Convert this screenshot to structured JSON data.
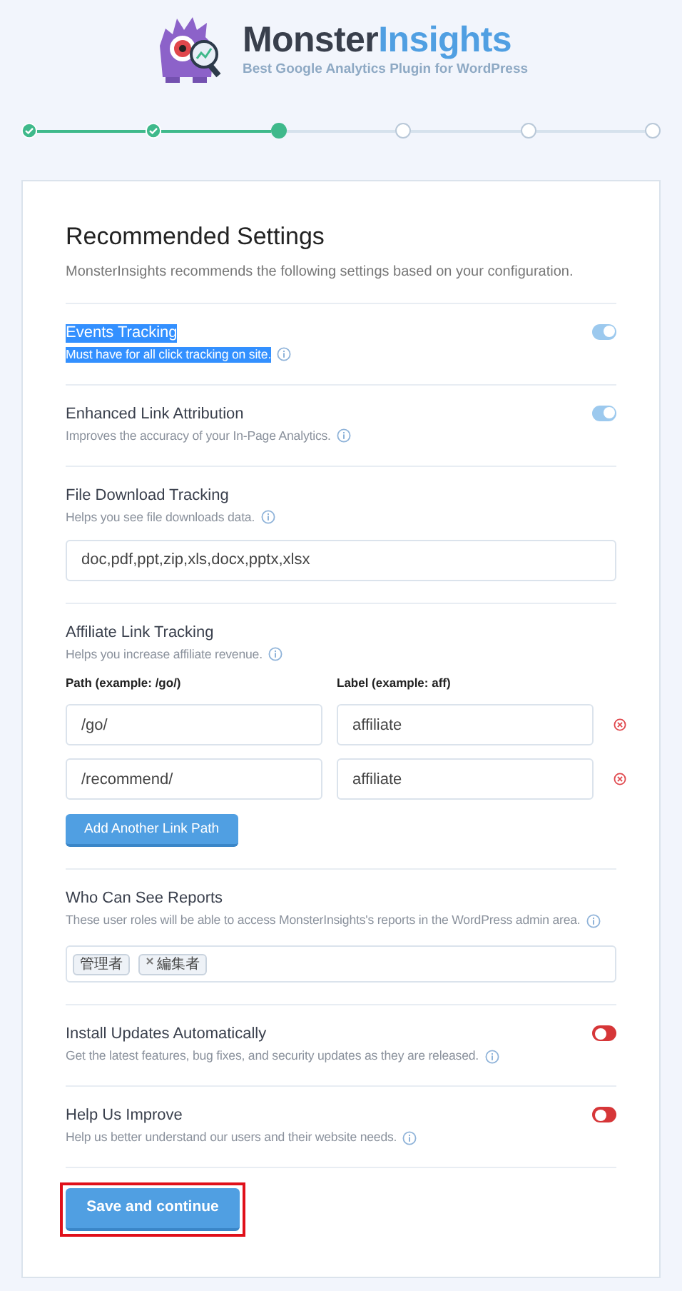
{
  "brand": {
    "name_first": "Monster",
    "name_second": "Insights",
    "tagline": "Best Google Analytics Plugin for WordPress"
  },
  "steps": [
    {
      "checked": true,
      "selected": false
    },
    {
      "checked": true,
      "selected": false
    },
    {
      "checked": false,
      "selected": true
    },
    {
      "checked": false,
      "selected": false
    },
    {
      "checked": false,
      "selected": false
    },
    {
      "checked": false,
      "selected": false
    }
  ],
  "card": {
    "title": "Recommended Settings",
    "subtitle": "MonsterInsights recommends the following settings based on your configuration.",
    "settings": [
      {
        "kind": "toggle",
        "label": "Events Tracking",
        "description": "Must have for all click tracking on site.",
        "highlighted": true,
        "on": true
      },
      {
        "kind": "toggle",
        "label": "Enhanced Link Attribution",
        "description": "Improves the accuracy of your In-Page Analytics.",
        "highlighted": false,
        "on": true
      },
      {
        "kind": "text",
        "label": "File Download Tracking",
        "description": "Helps you see file downloads data.",
        "highlighted": false,
        "value": "doc,pdf,ppt,zip,xls,docx,pptx,xlsx"
      },
      {
        "kind": "affiliate",
        "label": "Affiliate Link Tracking",
        "description": "Helps you increase affiliate revenue.",
        "highlighted": false,
        "path_header": "Path (example: /go/)",
        "label_header": "Label (example: aff)",
        "rows": [
          {
            "path": "/go/",
            "label": "affiliate"
          },
          {
            "path": "/recommend/",
            "label": "affiliate"
          }
        ],
        "add_button": "Add Another Link Path"
      },
      {
        "kind": "roles",
        "label": "Who Can See Reports",
        "description": "These user roles will be able to access MonsterInsights's reports in the WordPress admin area.",
        "highlighted": false,
        "roles": [
          {
            "name": "管理者",
            "removable": false
          },
          {
            "name": "編集者",
            "removable": true
          }
        ]
      },
      {
        "kind": "toggle",
        "label": "Install Updates Automatically",
        "description": "Get the latest features, bug fixes, and security updates as they are released.",
        "highlighted": false,
        "on": false
      },
      {
        "kind": "toggle",
        "label": "Help Us Improve",
        "description": "Help us better understand our users and their website needs.",
        "highlighted": false,
        "on": false
      }
    ],
    "save_button": "Save and continue"
  }
}
